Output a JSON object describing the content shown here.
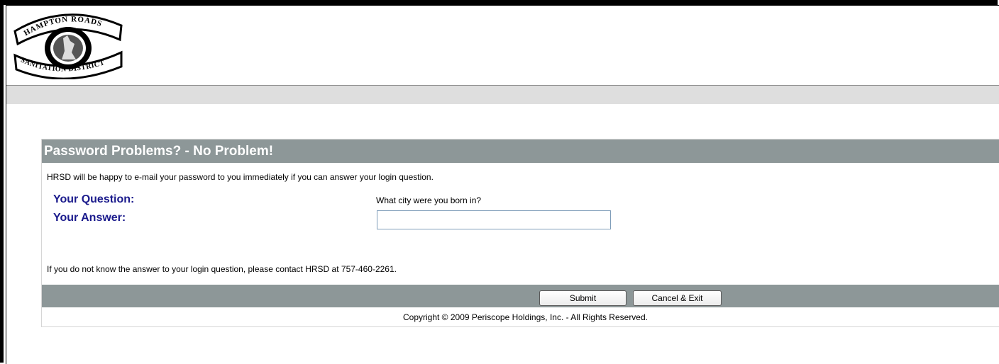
{
  "logo": {
    "top_text": "HAMPTON ROADS",
    "bottom_text": "SANITATION DISTRICT"
  },
  "form": {
    "title": "Password Problems? - No Problem!",
    "intro": "HRSD will be happy to e-mail your password to you immediately if you can answer your login question.",
    "question_label": "Your Question:",
    "question_value": "What city were you born in?",
    "answer_label": "Your Answer:",
    "answer_value": "",
    "contact_text": "If you do not know the answer to your login question, please contact HRSD at 757-460-2261."
  },
  "buttons": {
    "submit": "Submit",
    "cancel": "Cancel & Exit"
  },
  "footer": {
    "copyright": "Copyright © 2009 Periscope Holdings, Inc. - All Rights Reserved."
  },
  "colors": {
    "header_bar": "#8d9798",
    "label_text": "#1a1a8c",
    "gray_bar": "#dedede"
  }
}
